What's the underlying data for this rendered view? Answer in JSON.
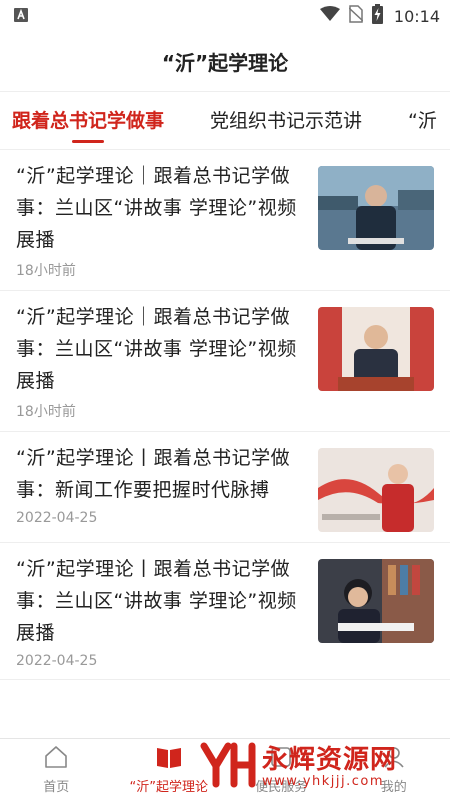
{
  "status_bar": {
    "time": "10:14"
  },
  "header": {
    "title": "“沂”起学理论"
  },
  "tabs": [
    {
      "label": "跟着总书记学做事",
      "active": true
    },
    {
      "label": "党组织书记示范讲",
      "active": false
    },
    {
      "label": "“沂",
      "active": false
    }
  ],
  "news": [
    {
      "title": "“沂”起学理论｜跟着总书记学做事：兰山区“讲故事 学理论”视频展播",
      "time": "18小时前"
    },
    {
      "title": "“沂”起学理论｜跟着总书记学做事：兰山区“讲故事 学理论”视频展播",
      "time": "18小时前"
    },
    {
      "title": "“沂”起学理论丨跟着总书记学做事：新闻工作要把握时代脉搏",
      "time": "2022-04-25"
    },
    {
      "title": "“沂”起学理论丨跟着总书记学做事：兰山区“讲故事 学理论”视频展播",
      "time": "2022-04-25"
    }
  ],
  "bottom_nav": [
    {
      "label": "首页",
      "icon": "home-icon",
      "active": false
    },
    {
      "label": "“沂”起学理论",
      "icon": "book-icon",
      "active": true
    },
    {
      "label": "便民服务",
      "icon": "service-icon",
      "active": false
    },
    {
      "label": "我的",
      "icon": "user-icon",
      "active": false
    }
  ],
  "watermark": {
    "main": "永辉资源网",
    "url": "www.yhkjjj.com"
  },
  "colors": {
    "accent": "#d0251c",
    "muted": "#999999"
  }
}
